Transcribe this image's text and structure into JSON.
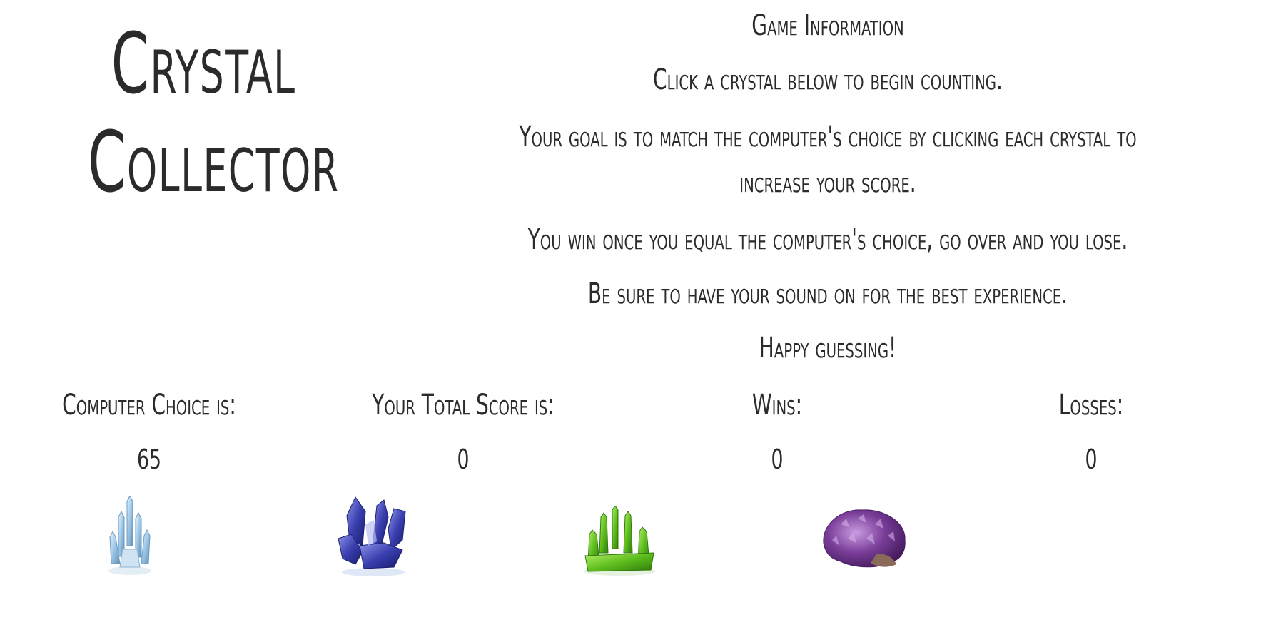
{
  "title": {
    "line1": "Crystal",
    "line2": "Collector"
  },
  "info": {
    "heading": "Game Information",
    "instruction": "Click a crystal below to begin counting.",
    "goal": "Your goal is to match the computer's choice by clicking each crystal to increase your score.",
    "rule": "You win once you equal the computer's choice, go over and you lose.",
    "sound": "Be sure to have your sound on for the best experience.",
    "closing": "Happy guessing!"
  },
  "stats": {
    "computer_choice_label": "Computer Choice is:",
    "computer_choice_value": "65",
    "total_score_label": "Your Total Score is:",
    "total_score_value": "0",
    "wins_label": "Wins:",
    "wins_value": "0",
    "losses_label": "Losses:",
    "losses_value": "0"
  },
  "crystals": [
    {
      "name": "clear-quartz-crystal-icon",
      "color": "#9cc6e6"
    },
    {
      "name": "blue-sapphire-crystal-icon",
      "color": "#3a3fb0"
    },
    {
      "name": "green-peridot-crystal-icon",
      "color": "#5fbf1e"
    },
    {
      "name": "purple-amethyst-crystal-icon",
      "color": "#7a3e9a"
    }
  ]
}
